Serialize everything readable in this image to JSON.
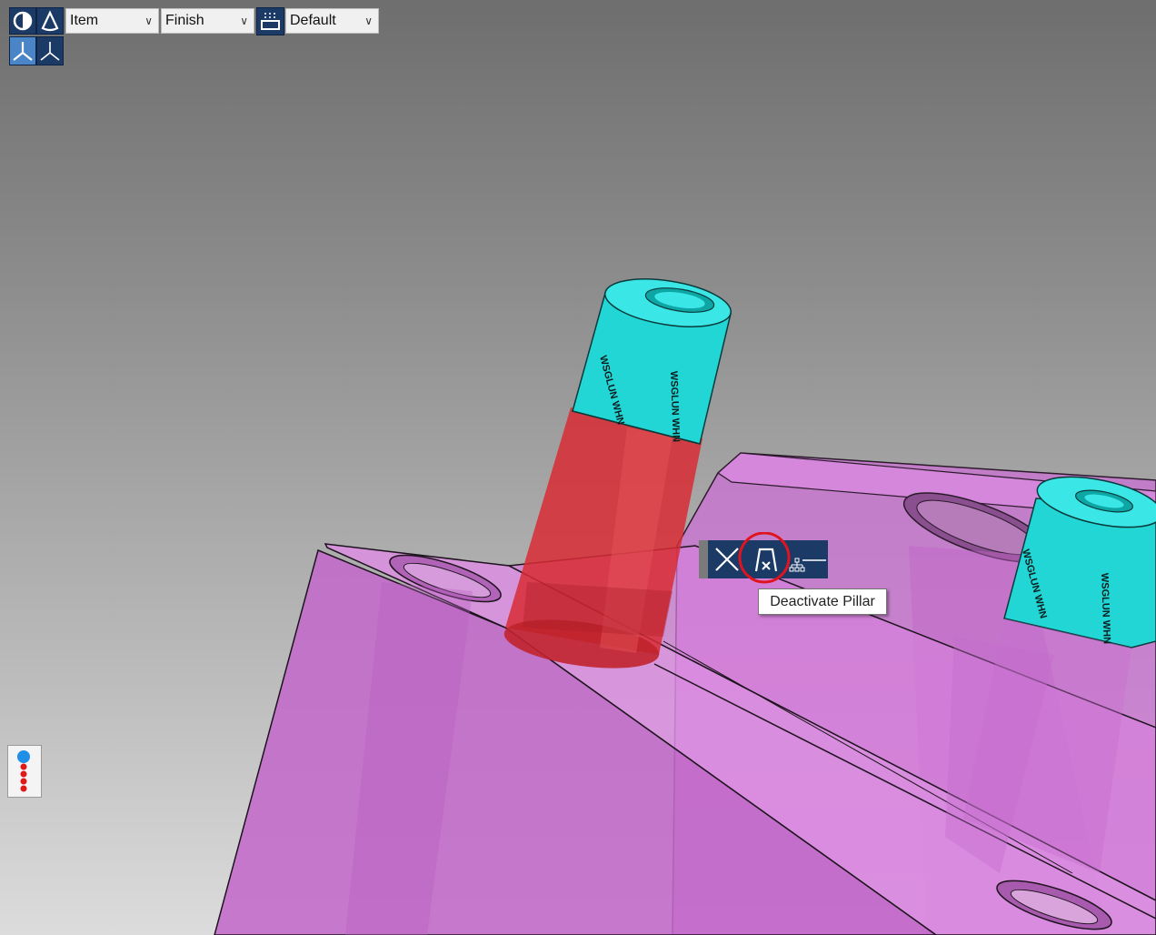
{
  "window": {
    "title": ""
  },
  "toolbar": {
    "view_mode_icons": [
      "sphere-shade-icon",
      "cone-outline-icon"
    ],
    "axis_icons": [
      "axis-triad-solid-icon",
      "axis-triad-outline-icon"
    ],
    "selection_dropdown": {
      "value": "Item"
    },
    "stage_dropdown": {
      "value": "Finish"
    },
    "layer_icon": "layer-stack-icon",
    "layer_dropdown": {
      "value": "Default"
    }
  },
  "context_toolbar": {
    "buttons": [
      {
        "name": "close",
        "icon": "x-icon"
      },
      {
        "name": "deactivate-pillar",
        "icon": "pillar-deactivate-icon",
        "highlighted": true
      },
      {
        "name": "hierarchy",
        "icon": "hierarchy-tree-icon"
      }
    ]
  },
  "tooltip": {
    "text": "Deactivate Pillar"
  },
  "scene": {
    "pillar_labels": [
      "WSGLUN WHN",
      "WSGLUN WHN",
      "WSGLUN WHN",
      "WSGLUN WHN"
    ]
  },
  "colors": {
    "body_magenta": "#d979dd",
    "pillar_cyan": "#1fdcdc",
    "pillar_red": "#d82b34",
    "toolbar_blue": "#1b3a66",
    "highlight_ring": "#e0141e"
  }
}
